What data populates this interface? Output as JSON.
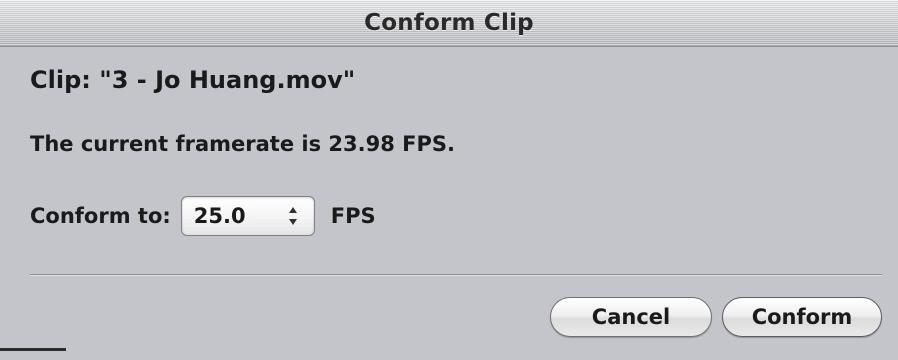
{
  "dialog": {
    "title": "Conform Clip",
    "clip_label": "Clip: \"3 - Jo Huang.mov\"",
    "framerate_text": "The current framerate is 23.98 FPS.",
    "conform_label": "Conform to:",
    "conform_value": "25.0",
    "conform_unit": "FPS",
    "buttons": {
      "cancel": "Cancel",
      "conform": "Conform"
    }
  },
  "icons": {
    "stepper": "up-down-arrows-icon"
  },
  "colors": {
    "window_bg": "#c3c5cb",
    "text": "#1a1a1a"
  }
}
